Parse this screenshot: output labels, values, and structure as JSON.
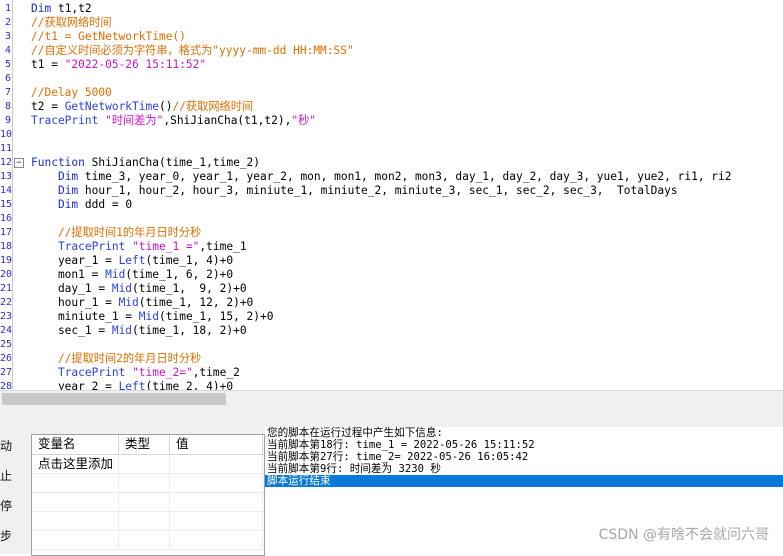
{
  "editor": {
    "lines": [
      {
        "n": "1",
        "segs": [
          {
            "c": "kw",
            "t": "Dim"
          },
          {
            "c": "pl",
            "t": " t1,t2"
          }
        ]
      },
      {
        "n": "2",
        "segs": [
          {
            "c": "cm",
            "t": "//获取网络时间"
          }
        ]
      },
      {
        "n": "3",
        "segs": [
          {
            "c": "cm",
            "t": "//t1 = GetNetworkTime()"
          }
        ]
      },
      {
        "n": "4",
        "segs": [
          {
            "c": "cm",
            "t": "//自定义时间必须为字符串，格式为\"yyyy-mm-dd HH:MM:SS\""
          }
        ]
      },
      {
        "n": "5",
        "segs": [
          {
            "c": "pl",
            "t": "t1 = "
          },
          {
            "c": "str",
            "t": "\"2022-05-26 15:11:52\""
          }
        ]
      },
      {
        "n": "6",
        "segs": []
      },
      {
        "n": "7",
        "segs": [
          {
            "c": "cm",
            "t": "//Delay 5000"
          }
        ]
      },
      {
        "n": "8",
        "segs": [
          {
            "c": "pl",
            "t": "t2 = "
          },
          {
            "c": "fn",
            "t": "GetNetworkTime"
          },
          {
            "c": "pl",
            "t": "()"
          },
          {
            "c": "cm",
            "t": "//获取网络时间"
          }
        ]
      },
      {
        "n": "9",
        "segs": [
          {
            "c": "fn",
            "t": "TracePrint"
          },
          {
            "c": "pl",
            "t": " "
          },
          {
            "c": "str",
            "t": "\"时间差为\""
          },
          {
            "c": "pl",
            "t": ",ShiJianCha(t1,t2),"
          },
          {
            "c": "str",
            "t": "\"秒\""
          }
        ]
      },
      {
        "n": "10",
        "segs": []
      },
      {
        "n": "11",
        "segs": []
      },
      {
        "n": "12",
        "fold": "−",
        "segs": [
          {
            "c": "kw",
            "t": "Function"
          },
          {
            "c": "pl",
            "t": " ShiJianCha(time_1,time_2)"
          }
        ]
      },
      {
        "n": "13",
        "segs": [
          {
            "c": "pl",
            "t": "    "
          },
          {
            "c": "kw",
            "t": "Dim"
          },
          {
            "c": "pl",
            "t": " time_3, year_0, year_1, year_2, mon, mon1, mon2, mon3, day_1, day_2, day_3, yue1, yue2, ri1, ri2"
          }
        ]
      },
      {
        "n": "14",
        "segs": [
          {
            "c": "pl",
            "t": "    "
          },
          {
            "c": "kw",
            "t": "Dim"
          },
          {
            "c": "pl",
            "t": " hour_1, hour_2, hour_3, miniute_1, miniute_2, miniute_3, sec_1, sec_2, sec_3,  TotalDays"
          }
        ]
      },
      {
        "n": "15",
        "segs": [
          {
            "c": "pl",
            "t": "    "
          },
          {
            "c": "kw",
            "t": "Dim"
          },
          {
            "c": "pl",
            "t": " ddd = 0"
          }
        ]
      },
      {
        "n": "16",
        "segs": []
      },
      {
        "n": "17",
        "segs": [
          {
            "c": "pl",
            "t": "    "
          },
          {
            "c": "cm",
            "t": "//提取时间1的年月日时分秒"
          }
        ]
      },
      {
        "n": "18",
        "segs": [
          {
            "c": "pl",
            "t": "    "
          },
          {
            "c": "fn",
            "t": "TracePrint"
          },
          {
            "c": "pl",
            "t": " "
          },
          {
            "c": "str",
            "t": "\"time_1 =\""
          },
          {
            "c": "pl",
            "t": ",time_1"
          }
        ]
      },
      {
        "n": "19",
        "segs": [
          {
            "c": "pl",
            "t": "    year_1 = "
          },
          {
            "c": "fn",
            "t": "Left"
          },
          {
            "c": "pl",
            "t": "(time_1, 4)+0"
          }
        ]
      },
      {
        "n": "20",
        "segs": [
          {
            "c": "pl",
            "t": "    mon1 = "
          },
          {
            "c": "fn",
            "t": "Mid"
          },
          {
            "c": "pl",
            "t": "(time_1, 6, 2)+0"
          }
        ]
      },
      {
        "n": "21",
        "segs": [
          {
            "c": "pl",
            "t": "    day_1 = "
          },
          {
            "c": "fn",
            "t": "Mid"
          },
          {
            "c": "pl",
            "t": "(time_1,  9, 2)+0"
          }
        ]
      },
      {
        "n": "22",
        "segs": [
          {
            "c": "pl",
            "t": "    hour_1 = "
          },
          {
            "c": "fn",
            "t": "Mid"
          },
          {
            "c": "pl",
            "t": "(time_1, 12, 2)+0"
          }
        ]
      },
      {
        "n": "23",
        "segs": [
          {
            "c": "pl",
            "t": "    miniute_1 = "
          },
          {
            "c": "fn",
            "t": "Mid"
          },
          {
            "c": "pl",
            "t": "(time_1, 15, 2)+0"
          }
        ]
      },
      {
        "n": "24",
        "segs": [
          {
            "c": "pl",
            "t": "    sec_1 = "
          },
          {
            "c": "fn",
            "t": "Mid"
          },
          {
            "c": "pl",
            "t": "(time_1, 18, 2)+0"
          }
        ]
      },
      {
        "n": "25",
        "segs": []
      },
      {
        "n": "26",
        "segs": [
          {
            "c": "pl",
            "t": "    "
          },
          {
            "c": "cm",
            "t": "//提取时间2的年月日时分秒"
          }
        ]
      },
      {
        "n": "27",
        "segs": [
          {
            "c": "pl",
            "t": "    "
          },
          {
            "c": "fn",
            "t": "TracePrint"
          },
          {
            "c": "pl",
            "t": " "
          },
          {
            "c": "str",
            "t": "\"time_2=\""
          },
          {
            "c": "pl",
            "t": ",time_2"
          }
        ]
      },
      {
        "n": "28",
        "segs": [
          {
            "c": "pl",
            "t": "    year_2 = "
          },
          {
            "c": "fn",
            "t": "Left"
          },
          {
            "c": "pl",
            "t": "(time_2, 4)+0"
          }
        ]
      }
    ]
  },
  "side_buttons": [
    "启动",
    "终止",
    "暂停",
    "单步"
  ],
  "variables": {
    "columns": [
      "变量名",
      "类型",
      "值"
    ],
    "add_row": "点击这里添加"
  },
  "output": {
    "lines": [
      "您的脚本在运行过程中产生如下信息:",
      "当前脚本第18行: time_1 = 2022-05-26 15:11:52",
      "当前脚本第27行: time_2= 2022-05-26 16:05:42",
      "当前脚本第9行: 时间差为 3230 秒"
    ],
    "selected_line": "脚本运行结束"
  },
  "watermark": "CSDN @有啥不会就问六哥"
}
